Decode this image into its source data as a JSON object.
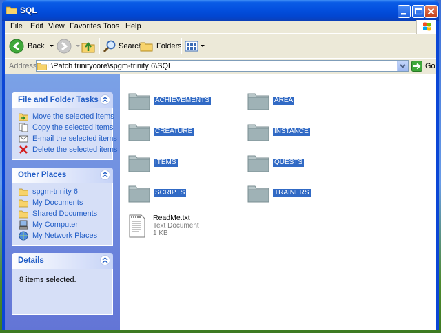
{
  "window": {
    "title": "SQL"
  },
  "menu": {
    "items": [
      "File",
      "Edit",
      "View",
      "Favorites",
      "Toos",
      "Help"
    ]
  },
  "toolbar": {
    "back_label": "Back",
    "search_label": "Search",
    "folders_label": "Folders"
  },
  "address": {
    "label": "Address",
    "value": "I:\\Patch trinitycore\\spgm-trinity 6\\SQL",
    "go_label": "Go"
  },
  "tasks_panel": {
    "title": "File and Folder Tasks",
    "items": [
      {
        "label": "Move the selected items",
        "icon": "move-icon"
      },
      {
        "label": "Copy the selected items",
        "icon": "copy-icon"
      },
      {
        "label": "E-mail the selected items",
        "icon": "email-icon"
      },
      {
        "label": "Delete the selected items",
        "icon": "delete-icon"
      }
    ]
  },
  "places_panel": {
    "title": "Other Places",
    "items": [
      {
        "label": "spgm-trinity 6",
        "icon": "folder-icon"
      },
      {
        "label": "My Documents",
        "icon": "folder-icon"
      },
      {
        "label": "Shared Documents",
        "icon": "folder-icon"
      },
      {
        "label": "My Computer",
        "icon": "computer-icon"
      },
      {
        "label": "My Network Places",
        "icon": "network-icon"
      }
    ]
  },
  "details_panel": {
    "title": "Details",
    "text": "8 items selected."
  },
  "folders": [
    "ACHIEVEMENTS",
    "AREA",
    "CREATURE",
    "INSTANCE",
    "ITEMS",
    "QUESTS",
    "SCRIPTS",
    "TRAINERS"
  ],
  "file": {
    "name": "ReadMe.txt",
    "type": "Text Document",
    "size": "1 KB"
  },
  "colors": {
    "selection": "#316ac5",
    "link": "#215dc6",
    "titlebar": "#0a46d6",
    "taskpane": "#7ba2e7"
  }
}
